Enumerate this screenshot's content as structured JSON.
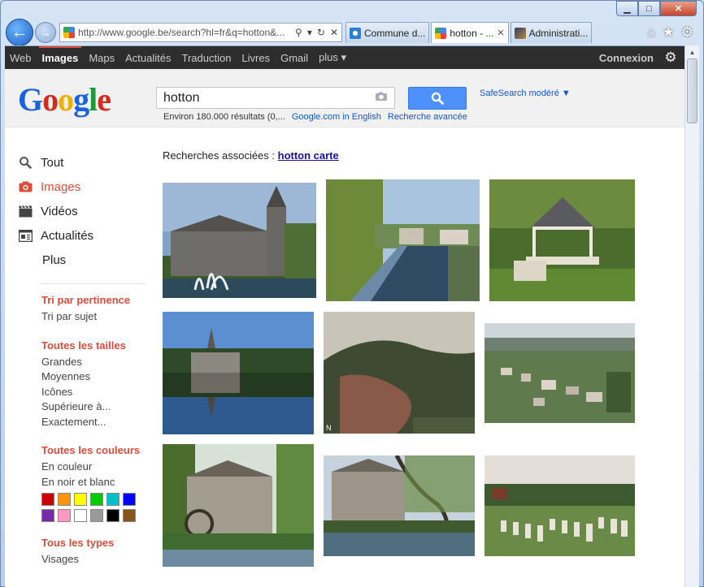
{
  "browser": {
    "address_url": "http://www.google.be/search?hl=fr&q=hotton&...",
    "tabs": [
      {
        "label": "Commune d...",
        "active": false,
        "icon_color": "#2a7fd4"
      },
      {
        "label": "hotton - ...",
        "active": true,
        "icon_color": "#4285f4"
      },
      {
        "label": "Administrati...",
        "active": false,
        "icon_color": "#7a5a2a"
      }
    ],
    "window_controls": {
      "minimize": "▁",
      "maximize": "□",
      "close": "✕"
    },
    "nav_icons": {
      "back": "←",
      "forward": "→"
    },
    "toolbar_icons": {
      "home": "⌂",
      "favorites": "★",
      "tools": "⚙"
    }
  },
  "gbar": {
    "items": [
      {
        "label": "Web",
        "active": false
      },
      {
        "label": "Images",
        "active": true
      },
      {
        "label": "Maps",
        "active": false
      },
      {
        "label": "Actualités",
        "active": false
      },
      {
        "label": "Traduction",
        "active": false
      },
      {
        "label": "Livres",
        "active": false
      },
      {
        "label": "Gmail",
        "active": false
      },
      {
        "label": "plus ▾",
        "active": false
      }
    ],
    "signin_label": "Connexion"
  },
  "header": {
    "logo": {
      "G": "G",
      "o1": "o",
      "o2": "o",
      "g": "g",
      "l": "l",
      "e": "e"
    },
    "query": "hotton",
    "safesearch_label": "SafeSearch modéré ▼",
    "result_stats": "Environ 180.000 résultats (0,...",
    "english_link": "Google.com in English",
    "advanced_link": "Recherche avancée",
    "colors": {
      "logo_blue": "#1a63e0",
      "logo_red": "#d62a1f",
      "logo_yellow": "#f0b000",
      "logo_green": "#1a9a3b",
      "search_btn": "#4d90fe"
    }
  },
  "leftnav": {
    "items": [
      {
        "label": "Tout",
        "icon": "search-icon",
        "active": false
      },
      {
        "label": "Images",
        "icon": "camera-icon",
        "active": true
      },
      {
        "label": "Vidéos",
        "icon": "film-icon",
        "active": false
      },
      {
        "label": "Actualités",
        "icon": "news-icon",
        "active": false
      }
    ],
    "plus_label": "Plus",
    "filters": [
      {
        "title": "Tri par pertinence",
        "options": [
          "Tri par sujet"
        ]
      },
      {
        "title": "Toutes les tailles",
        "options": [
          "Grandes",
          "Moyennes",
          "Icônes",
          "Supérieure à...",
          "Exactement..."
        ]
      },
      {
        "title": "Toutes les couleurs",
        "options": [
          "En couleur",
          "En noir et blanc"
        ]
      },
      {
        "title": "Tous les types",
        "options": [
          "Visages"
        ]
      }
    ],
    "color_swatches": [
      "#cc0000",
      "#fb940b",
      "#ffff00",
      "#00cc00",
      "#03c0c6",
      "#0000ff",
      "#762ca7",
      "#ff98bf",
      "#ffffff",
      "#999999",
      "#000000",
      "#885418"
    ]
  },
  "results": {
    "related_prefix": "Recherches associées : ",
    "related_link": "hotton carte"
  }
}
